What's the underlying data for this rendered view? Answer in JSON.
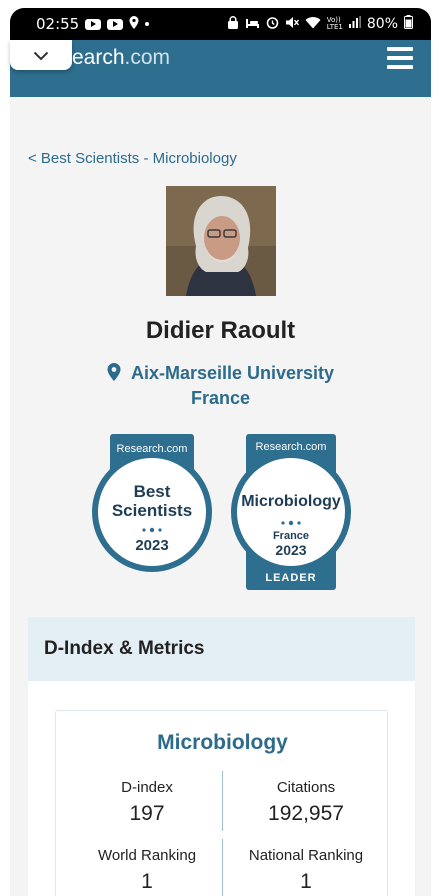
{
  "status_bar": {
    "time": "02:55",
    "battery": "80%",
    "volte": "Vo))",
    "lte": "LTE1"
  },
  "site": {
    "brand_main": "earch",
    "brand_tld": ".com",
    "menu_icon": "hamburger-icon",
    "collapse_icon": "chevron-down-icon"
  },
  "breadcrumb": "< Best Scientists - Microbiology",
  "profile": {
    "name": "Didier Raoult",
    "institution": "Aix-Marseille University",
    "country": "France"
  },
  "badges": [
    {
      "header": "Research.com",
      "line1": "Best",
      "line2": "Scientists",
      "year": "2023"
    },
    {
      "header": "Research.com",
      "line1": "Microbiology",
      "line2": "France",
      "year": "2023",
      "ribbon": "LEADER"
    }
  ],
  "metrics": {
    "section_title": "D-Index & Metrics",
    "field": "Microbiology",
    "items": [
      {
        "label": "D-index",
        "value": "197"
      },
      {
        "label": "Citations",
        "value": "192,957"
      },
      {
        "label": "World Ranking",
        "value": "1"
      },
      {
        "label": "National Ranking",
        "value": "1"
      }
    ]
  },
  "colors": {
    "brand_blue": "#2e6e8e",
    "link_blue": "#2c6b8b",
    "metrics_header_bg": "#e3eff5"
  }
}
